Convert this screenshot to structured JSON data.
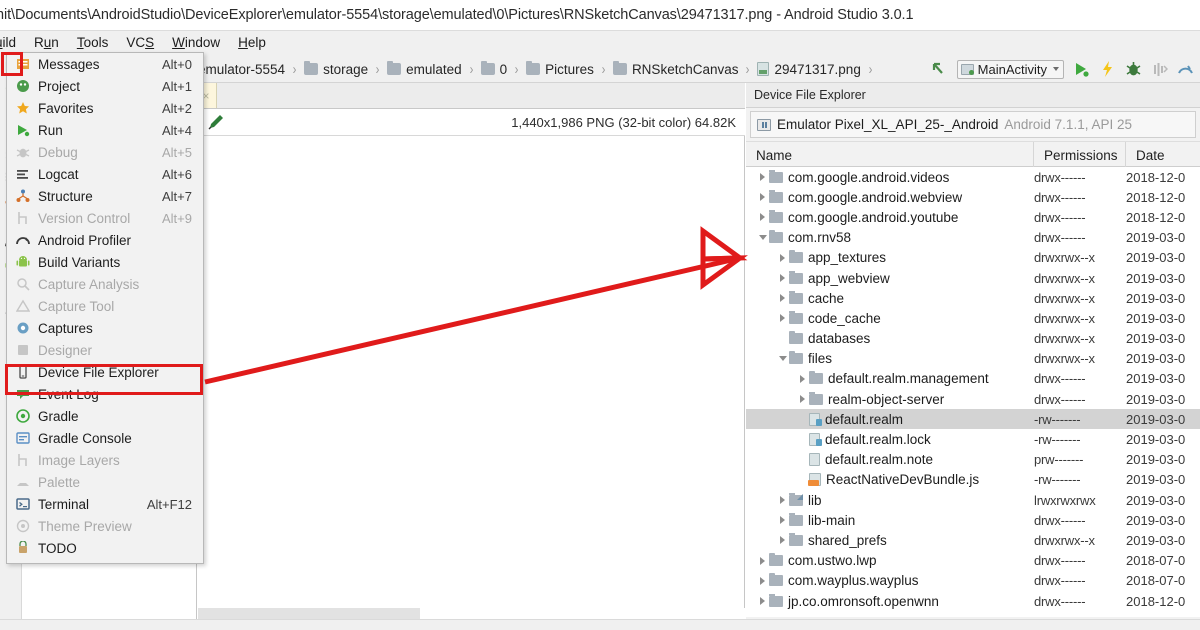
{
  "window": {
    "title": "nit\\Documents\\AndroidStudio\\DeviceExplorer\\emulator-5554\\storage\\emulated\\0\\Pictures\\RNSketchCanvas\\29471317.png - Android Studio 3.0.1"
  },
  "menubar": {
    "items": [
      {
        "pre": "",
        "mn": "u",
        "post": "ild"
      },
      {
        "pre": "R",
        "mn": "u",
        "post": "n"
      },
      {
        "pre": "",
        "mn": "T",
        "post": "ools"
      },
      {
        "pre": "VC",
        "mn": "S",
        "post": ""
      },
      {
        "pre": "",
        "mn": "W",
        "post": "indow"
      },
      {
        "pre": "",
        "mn": "H",
        "post": "elp"
      }
    ]
  },
  "breadcrumb": {
    "items": [
      {
        "label": "emulator-5554",
        "icon": "none"
      },
      {
        "label": "storage",
        "icon": "folder-icon"
      },
      {
        "label": "emulated",
        "icon": "folder-icon"
      },
      {
        "label": "0",
        "icon": "folder-icon"
      },
      {
        "label": "Pictures",
        "icon": "folder-icon"
      },
      {
        "label": "RNSketchCanvas",
        "icon": "folder-icon"
      },
      {
        "label": "29471317.png",
        "icon": "png-file-icon"
      }
    ],
    "separator": "›"
  },
  "run_toolbar": {
    "config_label": "MainActivity",
    "buttons": [
      {
        "name": "navigate-back-icon",
        "color": "#4a8b4a"
      },
      {
        "name": "run-icon",
        "color": "#4caf50"
      },
      {
        "name": "apply-changes-icon",
        "color": "#f5c518"
      },
      {
        "name": "debug-icon",
        "color": "#4a8b4a"
      },
      {
        "name": "attach-debugger-icon",
        "color": "#b9b9b9"
      },
      {
        "name": "android-profiler-icon",
        "color": "#5b93b8"
      }
    ]
  },
  "editor": {
    "tab_close": "×",
    "image_info": "1,440x1,986 PNG (32-bit color) 64.82K",
    "dropper_icon": "color-picker-icon"
  },
  "device_file_explorer": {
    "panel_title": "Device File Explorer",
    "device_name": "Emulator Pixel_XL_API_25-_Android",
    "device_detail": "Android 7.1.1, API 25",
    "columns": [
      "Name",
      "Permissions",
      "Date"
    ],
    "rows": [
      {
        "indent": 1,
        "twisty": "right",
        "icon": "folder",
        "name": "com.google.android.videos",
        "perm": "drwx------",
        "date": "2018-12-0",
        "selected": false
      },
      {
        "indent": 1,
        "twisty": "right",
        "icon": "folder",
        "name": "com.google.android.webview",
        "perm": "drwx------",
        "date": "2018-12-0",
        "selected": false
      },
      {
        "indent": 1,
        "twisty": "right",
        "icon": "folder",
        "name": "com.google.android.youtube",
        "perm": "drwx------",
        "date": "2018-12-0",
        "selected": false
      },
      {
        "indent": 1,
        "twisty": "down",
        "icon": "folder",
        "name": "com.rnv58",
        "perm": "drwx------",
        "date": "2019-03-0",
        "selected": false
      },
      {
        "indent": 2,
        "twisty": "right",
        "icon": "folder",
        "name": "app_textures",
        "perm": "drwxrwx--x",
        "date": "2019-03-0",
        "selected": false
      },
      {
        "indent": 2,
        "twisty": "right",
        "icon": "folder",
        "name": "app_webview",
        "perm": "drwxrwx--x",
        "date": "2019-03-0",
        "selected": false
      },
      {
        "indent": 2,
        "twisty": "right",
        "icon": "folder",
        "name": "cache",
        "perm": "drwxrwx--x",
        "date": "2019-03-0",
        "selected": false
      },
      {
        "indent": 2,
        "twisty": "right",
        "icon": "folder",
        "name": "code_cache",
        "perm": "drwxrwx--x",
        "date": "2019-03-0",
        "selected": false
      },
      {
        "indent": 2,
        "twisty": "none",
        "icon": "folder",
        "name": "databases",
        "perm": "drwxrwx--x",
        "date": "2019-03-0",
        "selected": false
      },
      {
        "indent": 2,
        "twisty": "down",
        "icon": "folder",
        "name": "files",
        "perm": "drwxrwx--x",
        "date": "2019-03-0",
        "selected": false
      },
      {
        "indent": 3,
        "twisty": "right",
        "icon": "folder",
        "name": "default.realm.management",
        "perm": "drwx------",
        "date": "2019-03-0",
        "selected": false
      },
      {
        "indent": 3,
        "twisty": "right",
        "icon": "folder",
        "name": "realm-object-server",
        "perm": "drwx------",
        "date": "2019-03-0",
        "selected": false
      },
      {
        "indent": 3,
        "twisty": "none",
        "icon": "file-q",
        "name": "default.realm",
        "perm": "-rw-------",
        "date": "2019-03-0",
        "selected": true
      },
      {
        "indent": 3,
        "twisty": "none",
        "icon": "file-q",
        "name": "default.realm.lock",
        "perm": "-rw-------",
        "date": "2019-03-0",
        "selected": false
      },
      {
        "indent": 3,
        "twisty": "none",
        "icon": "file",
        "name": "default.realm.note",
        "perm": "prw-------",
        "date": "2019-03-0",
        "selected": false
      },
      {
        "indent": 3,
        "twisty": "none",
        "icon": "js",
        "name": "ReactNativeDevBundle.js",
        "perm": "-rw-------",
        "date": "2019-03-0",
        "selected": false
      },
      {
        "indent": 2,
        "twisty": "right",
        "icon": "link",
        "name": "lib",
        "perm": "lrwxrwxrwx",
        "date": "2019-03-0",
        "selected": false
      },
      {
        "indent": 2,
        "twisty": "right",
        "icon": "folder",
        "name": "lib-main",
        "perm": "drwx------",
        "date": "2019-03-0",
        "selected": false
      },
      {
        "indent": 2,
        "twisty": "right",
        "icon": "folder",
        "name": "shared_prefs",
        "perm": "drwxrwx--x",
        "date": "2019-03-0",
        "selected": false
      },
      {
        "indent": 1,
        "twisty": "right",
        "icon": "folder",
        "name": "com.ustwo.lwp",
        "perm": "drwx------",
        "date": "2018-07-0",
        "selected": false
      },
      {
        "indent": 1,
        "twisty": "right",
        "icon": "folder",
        "name": "com.wayplus.wayplus",
        "perm": "drwx------",
        "date": "2018-07-0",
        "selected": false
      },
      {
        "indent": 1,
        "twisty": "right",
        "icon": "folder",
        "name": "jp.co.omronsoft.openwnn",
        "perm": "drwx------",
        "date": "2018-12-0",
        "selected": false
      }
    ]
  },
  "tool_window_menu": {
    "items": [
      {
        "label": "Messages",
        "shortcut": "Alt+0",
        "icon": "messages-icon",
        "color": "#e8a33d",
        "disabled": false
      },
      {
        "label": "Project",
        "shortcut": "Alt+1",
        "icon": "project-icon",
        "color": "#4b9b4b",
        "disabled": false
      },
      {
        "label": "Favorites",
        "shortcut": "Alt+2",
        "icon": "star-icon",
        "color": "#f0a81e",
        "disabled": false
      },
      {
        "label": "Run",
        "shortcut": "Alt+4",
        "icon": "run-icon",
        "color": "#3fa93f",
        "disabled": false
      },
      {
        "label": "Debug",
        "shortcut": "Alt+5",
        "icon": "debug-icon",
        "color": "#b9b9b9",
        "disabled": true
      },
      {
        "label": "Logcat",
        "shortcut": "Alt+6",
        "icon": "logcat-icon",
        "color": "#4a4a4a",
        "disabled": false
      },
      {
        "label": "Structure",
        "shortcut": "Alt+7",
        "icon": "structure-icon",
        "color": "#d4702a",
        "disabled": false
      },
      {
        "label": "Version Control",
        "shortcut": "Alt+9",
        "icon": "version-control-icon",
        "color": "#bdbdbd",
        "disabled": true
      },
      {
        "label": "Android Profiler",
        "shortcut": "",
        "icon": "android-profiler-icon",
        "color": "#3c3c3c",
        "disabled": false
      },
      {
        "label": "Build Variants",
        "shortcut": "",
        "icon": "android-icon",
        "color": "#8bc34a",
        "disabled": false
      },
      {
        "label": "Capture Analysis",
        "shortcut": "",
        "icon": "capture-analysis-icon",
        "color": "#c6c6c6",
        "disabled": true
      },
      {
        "label": "Capture Tool",
        "shortcut": "",
        "icon": "capture-tool-icon",
        "color": "#c6c6c6",
        "disabled": true
      },
      {
        "label": "Captures",
        "shortcut": "",
        "icon": "captures-icon",
        "color": "#6a9fc4",
        "disabled": false
      },
      {
        "label": "Designer",
        "shortcut": "",
        "icon": "designer-icon",
        "color": "#c6c6c6",
        "disabled": true
      },
      {
        "label": "Device File Explorer",
        "shortcut": "",
        "icon": "device-file-explorer-icon",
        "color": "#4a4a4a",
        "disabled": false
      },
      {
        "label": "Event Log",
        "shortcut": "",
        "icon": "event-log-icon",
        "color": "#4b9b4b",
        "disabled": false
      },
      {
        "label": "Gradle",
        "shortcut": "",
        "icon": "gradle-icon",
        "color": "#3fa93f",
        "disabled": false
      },
      {
        "label": "Gradle Console",
        "shortcut": "",
        "icon": "gradle-console-icon",
        "color": "#5b8fc4",
        "disabled": false
      },
      {
        "label": "Image Layers",
        "shortcut": "",
        "icon": "image-layers-icon",
        "color": "#c6c6c6",
        "disabled": true
      },
      {
        "label": "Palette",
        "shortcut": "",
        "icon": "palette-icon",
        "color": "#c6c6c6",
        "disabled": true
      },
      {
        "label": "Terminal",
        "shortcut": "Alt+F12",
        "icon": "terminal-icon",
        "color": "#4a6b8a",
        "disabled": false
      },
      {
        "label": "Theme Preview",
        "shortcut": "",
        "icon": "theme-preview-icon",
        "color": "#c6c6c6",
        "disabled": true
      },
      {
        "label": "TODO",
        "shortcut": "",
        "icon": "todo-icon",
        "color": "#4a8b4a",
        "disabled": false
      }
    ]
  },
  "annotation": {
    "highlight_color": "#e01b1b",
    "target_label": "Device File Explorer"
  }
}
